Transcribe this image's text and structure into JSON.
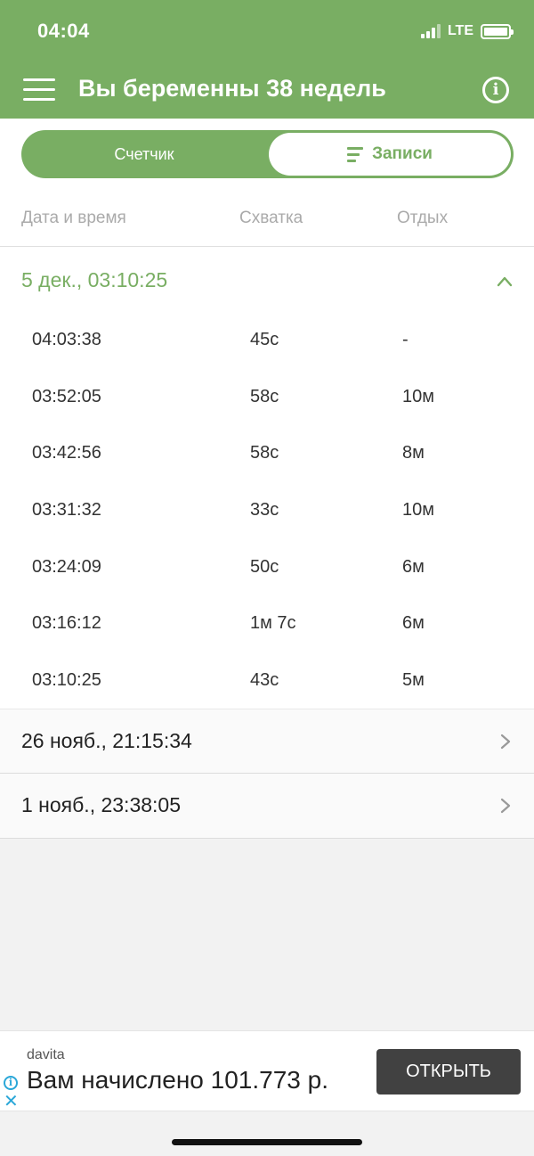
{
  "status": {
    "time": "04:04",
    "network": "LTE"
  },
  "header": {
    "title": "Вы беременны 38 недель"
  },
  "segment": {
    "counter": "Счетчик",
    "records": "Записи"
  },
  "table": {
    "col_datetime": "Дата и время",
    "col_contraction": "Схватка",
    "col_rest": "Отдых"
  },
  "open_group": {
    "title": "5 дек., 03:10:25",
    "rows": [
      {
        "time": "04:03:38",
        "contraction": "45с",
        "rest": "-"
      },
      {
        "time": "03:52:05",
        "contraction": "58с",
        "rest": "10м"
      },
      {
        "time": "03:42:56",
        "contraction": "58с",
        "rest": "8м"
      },
      {
        "time": "03:31:32",
        "contraction": "33с",
        "rest": "10м"
      },
      {
        "time": "03:24:09",
        "contraction": "50с",
        "rest": "6м"
      },
      {
        "time": "03:16:12",
        "contraction": "1м 7с",
        "rest": "6м"
      },
      {
        "time": "03:10:25",
        "contraction": "43с",
        "rest": "5м"
      }
    ]
  },
  "closed_groups": [
    {
      "title": "26 нояб., 21:15:34"
    },
    {
      "title": "1 нояб., 23:38:05"
    }
  ],
  "ad": {
    "brand": "davita",
    "text": "Вам начислено 101.773 р.",
    "button": "ОТКРЫТЬ"
  },
  "colors": {
    "accent": "#79ae63",
    "ad_button": "#414141",
    "ad_icons": "#2aa7d8"
  },
  "icons": {
    "menu": "hamburger-icon",
    "info": "info-icon",
    "records": "list-icon",
    "expand": "chevron-up-icon",
    "collapsed": "chevron-right-icon"
  }
}
